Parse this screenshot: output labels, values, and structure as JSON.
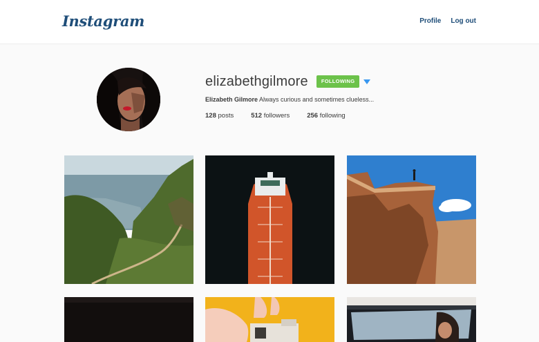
{
  "header": {
    "logo": "Instagram",
    "nav": {
      "profile": "Profile",
      "logout": "Log out"
    }
  },
  "profile": {
    "username": "elizabethgilmore",
    "follow_button": "FOLLOWING",
    "full_name": "Elizabeth Gilmore",
    "bio": "Always curious and sometimes clueless...",
    "stats": {
      "posts_count": "128",
      "posts_label": "posts",
      "followers_count": "512",
      "followers_label": "followers",
      "following_count": "256",
      "following_label": "following"
    }
  },
  "colors": {
    "brand": "#1f4e79",
    "follow_green": "#6cc24a",
    "caret_blue": "#3897f0"
  },
  "posts": [
    {
      "subject": "coastal-cliff-trail"
    },
    {
      "subject": "tanker-ship-aerial"
    },
    {
      "subject": "sandstone-cliff-figure"
    },
    {
      "subject": "dark-photo"
    },
    {
      "subject": "hand-camera-yellow"
    },
    {
      "subject": "car-window-portrait"
    }
  ]
}
